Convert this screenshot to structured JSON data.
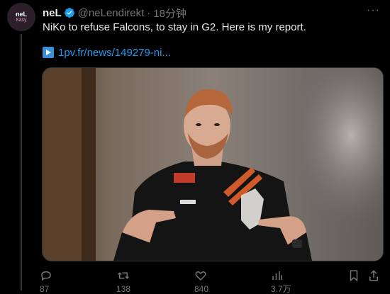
{
  "author": {
    "avatar_line1": "neL",
    "avatar_line2": "Ɛasy",
    "name": "neL",
    "handle": "@neLendirekt",
    "separator": "·",
    "time": "18分钟"
  },
  "tweet": {
    "text": "NiKo to refuse Falcons, to stay in G2. Here is my report.",
    "link_text": "1pv.fr/news/149279-ni..."
  },
  "media": {
    "description_icon": "photo-of-player-in-g2-jersey"
  },
  "actions": {
    "reply_count": "87",
    "retweet_count": "138",
    "like_count": "840",
    "views_count": "3.7万"
  },
  "colors": {
    "background": "#000000",
    "link": "#1d9bf0",
    "verified": "#1d9bf0",
    "muted": "#71767b"
  }
}
